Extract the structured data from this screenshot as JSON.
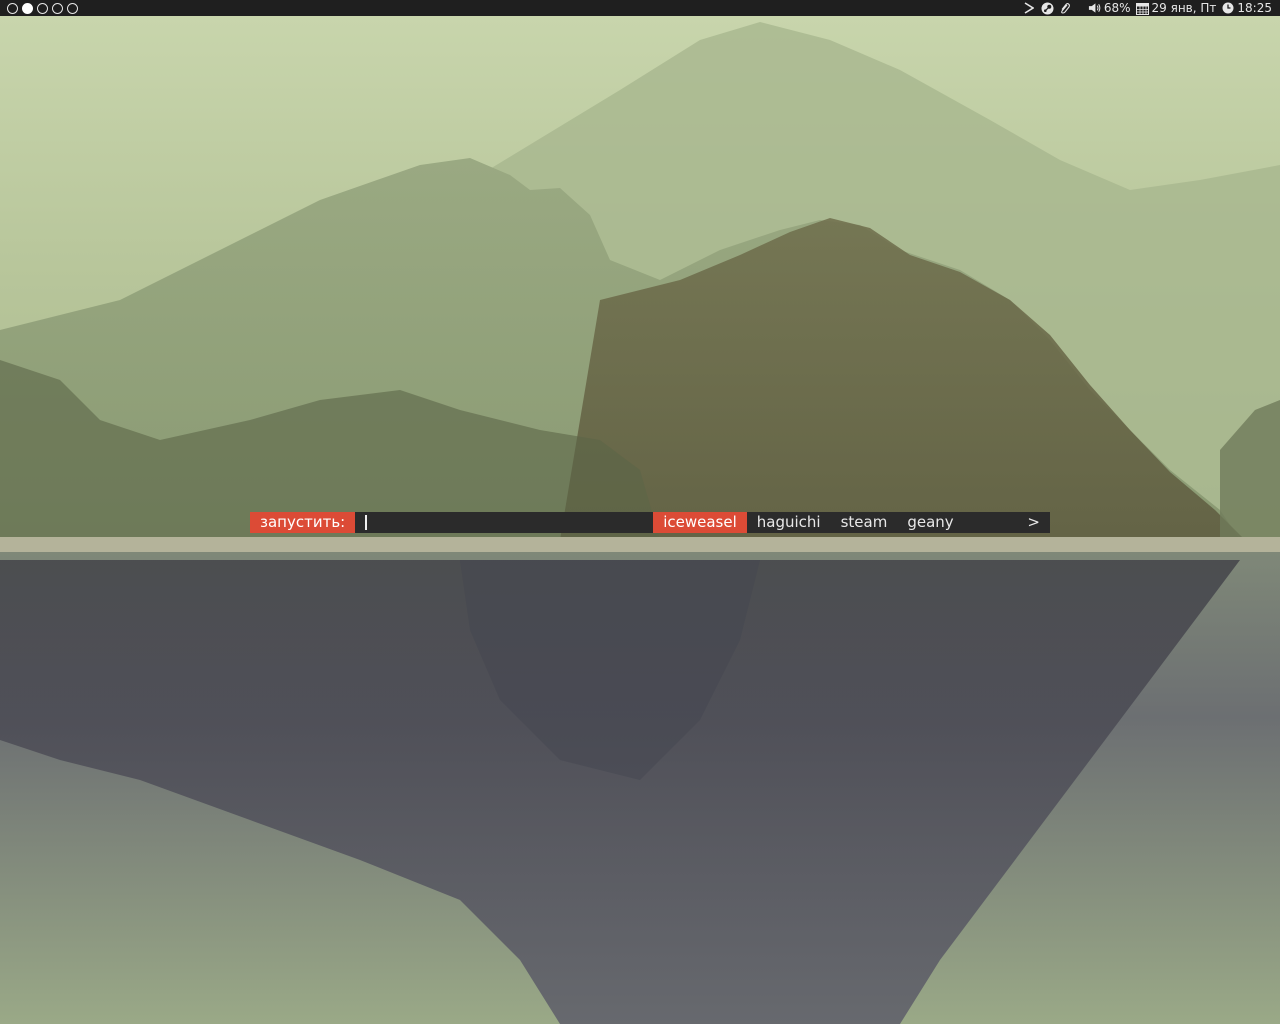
{
  "workspaces": {
    "count": 5,
    "active_index": 1
  },
  "tray": {
    "icons": [
      "terminal-arrow-icon",
      "steam-icon",
      "paperclip-icon"
    ],
    "volume_text": "68%",
    "date_text": "29 янв, Пт",
    "time_text": "18:25"
  },
  "launcher": {
    "prompt": "запустить:",
    "input_value": "",
    "items": [
      {
        "label": "iceweasel",
        "selected": true
      },
      {
        "label": "haguichi",
        "selected": false
      },
      {
        "label": "steam",
        "selected": false
      },
      {
        "label": "geany",
        "selected": false
      }
    ],
    "more_label": ">"
  },
  "colors": {
    "accent": "#dc4b36",
    "panel_bg": "#1f1f1f",
    "launcher_bg": "#2b2b2b"
  }
}
